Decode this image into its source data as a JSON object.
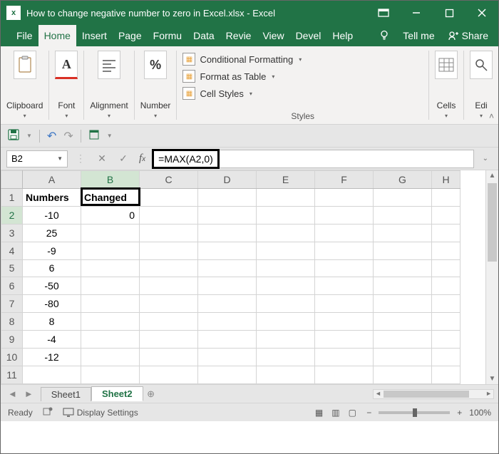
{
  "title": "How to change negative number to zero in Excel.xlsx  -  Excel",
  "tabs": [
    "File",
    "Home",
    "Insert",
    "Page",
    "Formu",
    "Data",
    "Revie",
    "View",
    "Devel",
    "Help"
  ],
  "active_tab_index": 1,
  "tellme": "Tell me",
  "share": "Share",
  "ribbon": {
    "clipboard": "Clipboard",
    "font": "Font",
    "alignment": "Alignment",
    "number": "Number",
    "cells": "Cells",
    "editing": "Edi",
    "styles_label": "Styles",
    "cond_format": "Conditional Formatting",
    "format_table": "Format as Table",
    "cell_styles": "Cell Styles"
  },
  "name_box": "B2",
  "formula": "=MAX(A2,0)",
  "columns": [
    "A",
    "B",
    "C",
    "D",
    "E",
    "F",
    "G",
    "H"
  ],
  "rows": [
    "1",
    "2",
    "3",
    "4",
    "5",
    "6",
    "7",
    "8",
    "9",
    "10",
    "11"
  ],
  "selected_col_index": 1,
  "selected_row_index": 1,
  "headers": {
    "A": "Numbers",
    "B": "Changed"
  },
  "col_a": [
    "-10",
    "25",
    "-9",
    "6",
    "-50",
    "-80",
    "8",
    "-4",
    "-12"
  ],
  "b2": "0",
  "sheets": [
    "Sheet1",
    "Sheet2"
  ],
  "active_sheet_index": 1,
  "status": {
    "ready": "Ready",
    "display": "Display Settings",
    "zoom": "100%"
  }
}
